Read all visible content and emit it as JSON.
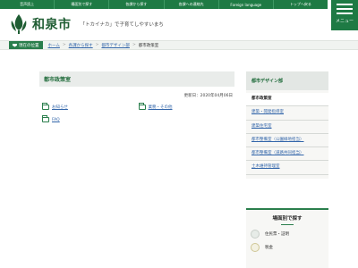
{
  "top_nav": [
    "音声読上",
    "場面別で探す",
    "各課から探す",
    "各課への連絡先",
    "Foreign language",
    "トップへ戻る"
  ],
  "menu_label": "メニュー",
  "site": {
    "name": "和泉市",
    "tagline": "「トカイナカ」で子育てしやすいまち"
  },
  "breadcrumb": {
    "here_label": "現在の位置",
    "items": [
      "ホーム",
      "各課から探す",
      "都市デザイン部"
    ],
    "current": "都市政策室"
  },
  "page": {
    "title": "都市政策室",
    "updated": "更新日：2020年04月06日",
    "folders": [
      "お知らせ",
      "業務・その他",
      "FAQ"
    ]
  },
  "sidebar": {
    "title": "都市デザイン部",
    "items": [
      "都市政策室",
      "建築・開発指導室",
      "建築住宅室",
      "都市整備室（公園緑地担当）",
      "都市整備室（道路共同担当）",
      "土木維持管理室"
    ]
  },
  "scene": {
    "title": "場面別で探す",
    "items": [
      "住民票・証明",
      "税金"
    ]
  },
  "colors": {
    "brand": "#1e7a44",
    "link": "#3366aa"
  }
}
